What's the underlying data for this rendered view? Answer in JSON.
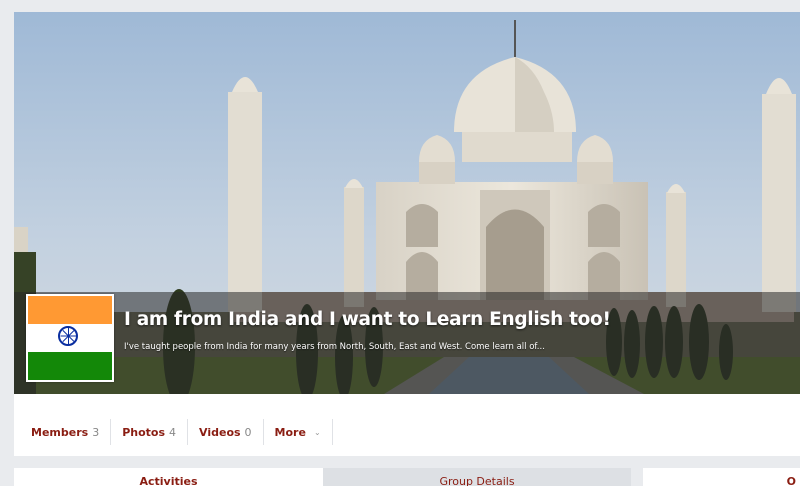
{
  "group": {
    "title": "I am from India and I want to Learn English too!",
    "description": "I've taught people from India for many years from North, South, East and West. Come learn all of..."
  },
  "nav": {
    "items": [
      {
        "label": "Members",
        "count": "3"
      },
      {
        "label": "Photos",
        "count": "4"
      },
      {
        "label": "Videos",
        "count": "0"
      },
      {
        "label": "More"
      }
    ]
  },
  "tabs": {
    "activities": "Activities",
    "group_details": "Group Details",
    "right_partial": "O"
  },
  "colors": {
    "accent": "#8a1d12",
    "page_bg": "#e9ebee"
  },
  "icons": {
    "more_caret": "chevron-down-icon"
  }
}
